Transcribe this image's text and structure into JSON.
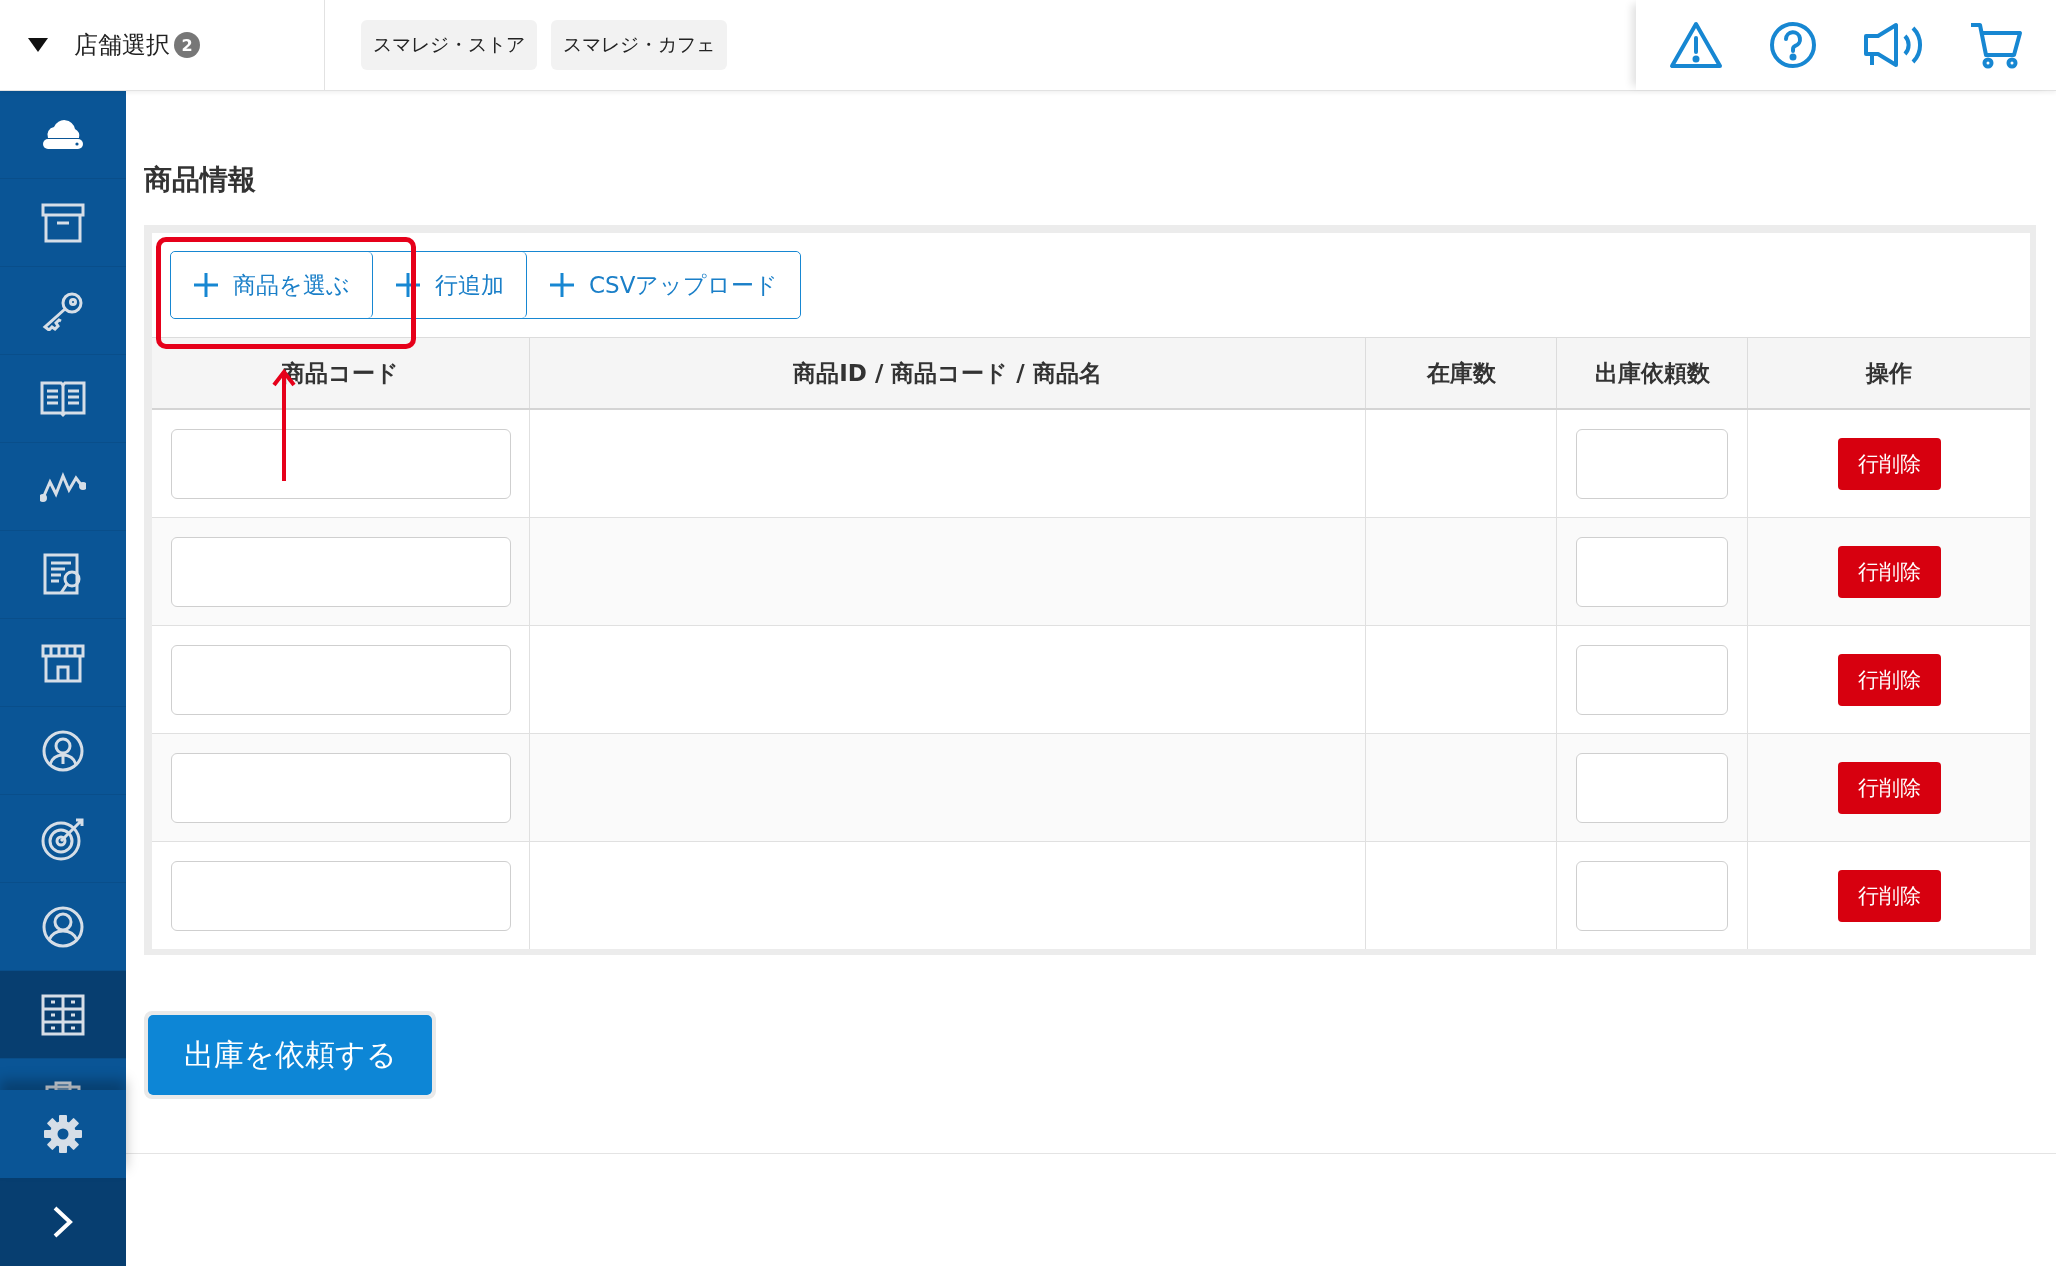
{
  "store_selector": {
    "label": "店舗選択",
    "count": "2",
    "expanded": true
  },
  "stores": [
    {
      "label": "スマレジ・ストア"
    },
    {
      "label": "スマレジ・カフェ"
    }
  ],
  "sidebar": {
    "items": [
      {
        "kind": "cloud",
        "selected": false
      },
      {
        "kind": "box",
        "selected": false
      },
      {
        "kind": "key",
        "selected": false
      },
      {
        "kind": "book",
        "selected": false
      },
      {
        "kind": "chart",
        "selected": false
      },
      {
        "kind": "report",
        "selected": false
      },
      {
        "kind": "store",
        "selected": false
      },
      {
        "kind": "staff",
        "selected": false
      },
      {
        "kind": "target",
        "selected": false
      },
      {
        "kind": "customer",
        "selected": false
      },
      {
        "kind": "inventory",
        "selected": true
      },
      {
        "kind": "clipboard",
        "selected": false
      }
    ]
  },
  "section_title": "商品情報",
  "toolbar": [
    {
      "label": "商品を選ぶ"
    },
    {
      "label": "行追加"
    },
    {
      "label": "CSVアップロード"
    }
  ],
  "table": {
    "columns": [
      "商品コード",
      "商品ID / 商品コード / 商品名",
      "在庫数",
      "出庫依頼数",
      "操作"
    ],
    "rows": [
      {
        "action": "行削除"
      },
      {
        "action": "行削除"
      },
      {
        "action": "行削除"
      },
      {
        "action": "行削除"
      },
      {
        "action": "行削除"
      }
    ]
  },
  "submit_button": "出庫を依頼する"
}
